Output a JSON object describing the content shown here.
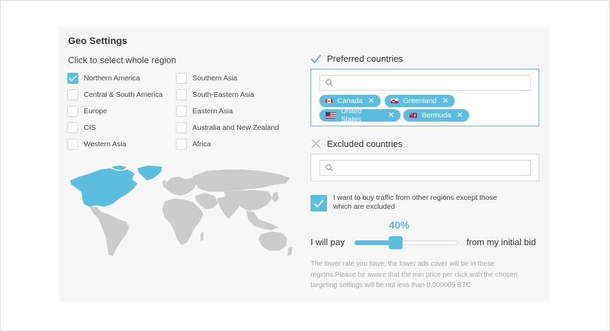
{
  "title": "Geo Settings",
  "subtitle": "Click to select whole region",
  "regions": [
    {
      "label": "Northern America",
      "checked": true
    },
    {
      "label": "Central & South America",
      "checked": false
    },
    {
      "label": "Europe",
      "checked": false
    },
    {
      "label": "CIS",
      "checked": false
    },
    {
      "label": "Western Asia",
      "checked": false
    },
    {
      "label": "Southern Asia",
      "checked": false
    },
    {
      "label": "South-Eastern Asia",
      "checked": false
    },
    {
      "label": "Eastern Asia",
      "checked": false
    },
    {
      "label": "Australia and New Zealand",
      "checked": false
    },
    {
      "label": "Africa",
      "checked": false
    }
  ],
  "preferred": {
    "heading": "Preferred countries",
    "icon": "check-icon",
    "search_placeholder": "",
    "countries": [
      {
        "name": "Canada",
        "flag": "flag-canada-icon"
      },
      {
        "name": "Greenland",
        "flag": "flag-greenland-icon"
      },
      {
        "name": "United States",
        "flag": "flag-united-states-icon"
      },
      {
        "name": "Bermuda",
        "flag": "flag-bermuda-icon"
      }
    ]
  },
  "excluded": {
    "heading": "Excluded countries",
    "icon": "cross-icon",
    "search_placeholder": ""
  },
  "other_regions": {
    "checked": true,
    "label": "I want to buy traffic from other regions except those which are excluded"
  },
  "bid": {
    "percent_label": "40%",
    "value": 0.4,
    "left_label": "I will pay",
    "right_label": "from my initial bid"
  },
  "note": "The lower rate you have, the lower ads cover will be in these regions.Please be aware that the min price per click with the chosen targeting settings will be not less than 0.000009 BTC",
  "colors": {
    "accent": "#5bbde0",
    "map_land": "#cccccc",
    "panel_bg": "#f7f7f7"
  }
}
